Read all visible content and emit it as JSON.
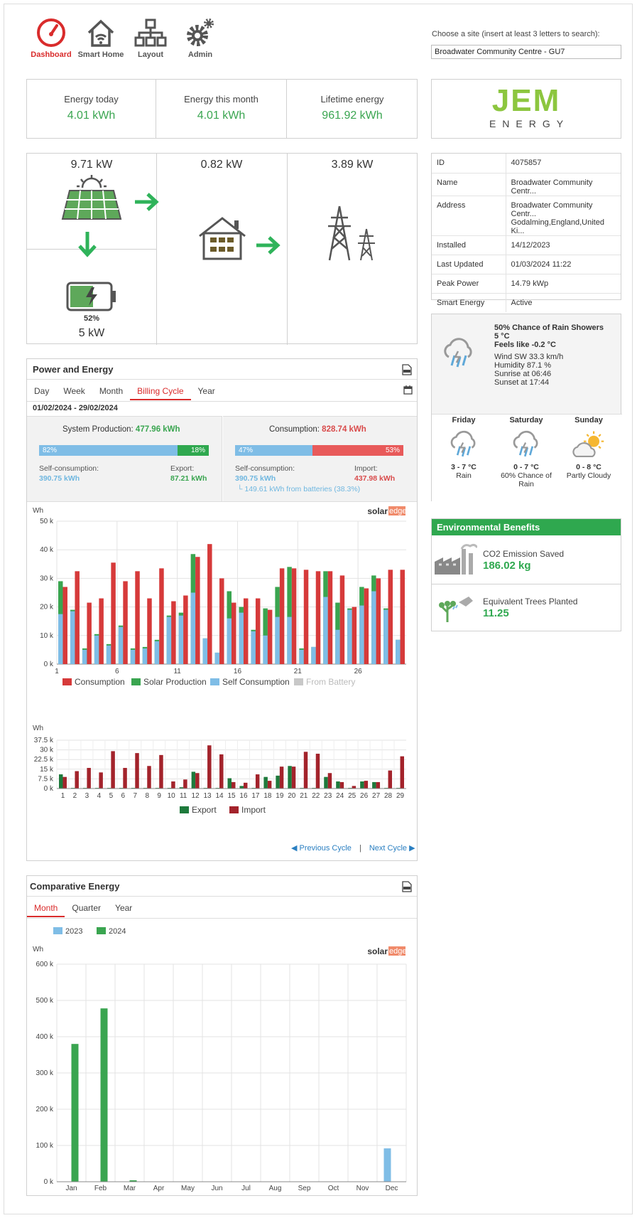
{
  "nav": [
    {
      "label": "Dashboard",
      "icon": "speedometer-icon",
      "active": true
    },
    {
      "label": "Smart Home",
      "icon": "smart-home-icon"
    },
    {
      "label": "Layout",
      "icon": "layout-tree-icon"
    },
    {
      "label": "Admin",
      "icon": "gears-icon"
    }
  ],
  "site_search": {
    "label": "Choose a site (insert at least 3 letters to search):",
    "value": "Broadwater Community Centre - GU7"
  },
  "stats": {
    "today_label": "Energy today",
    "today_value": "4.01 kWh",
    "month_label": "Energy this month",
    "month_value": "4.01 kWh",
    "lifetime_label": "Lifetime energy",
    "lifetime_value": "961.92 kWh"
  },
  "logo": {
    "top": "JEM",
    "bottom": "ENERGY"
  },
  "flow": {
    "solar_kw": "9.71 kW",
    "house_kw": "0.82 kW",
    "grid_kw": "3.89 kW",
    "battery_pct": "52%",
    "battery_kw": "5 kW"
  },
  "site_info": [
    {
      "k": "ID",
      "v": "4075857"
    },
    {
      "k": "Name",
      "v": "Broadwater Community Centr..."
    },
    {
      "k": "Address",
      "v": "Broadwater Community Centr...",
      "v2": "Godalming,England,United Ki..."
    },
    {
      "k": "Installed",
      "v": "14/12/2023"
    },
    {
      "k": "Last Updated",
      "v": "01/03/2024 11:22"
    },
    {
      "k": "Peak Power",
      "v": "14.79 kWp"
    },
    {
      "k": "Smart Energy",
      "v": "Active"
    }
  ],
  "weather": {
    "now": {
      "line1": "50% Chance of Rain Showers",
      "line2": "5 °C",
      "line3": "Feels like -0.2 °C",
      "wind": "Wind SW 33.3 km/h",
      "humidity": "Humidity 87.1 %",
      "sunrise": "Sunrise at 06:46",
      "sunset": "Sunset at 17:44"
    },
    "days": [
      {
        "day": "Friday",
        "temp": "3 - 7 °C",
        "desc": "Rain",
        "icon": "rain-cloud-icon"
      },
      {
        "day": "Saturday",
        "temp": "0 - 7 °C",
        "desc": "60% Chance of Rain",
        "icon": "rain-cloud-icon"
      },
      {
        "day": "Sunday",
        "temp": "0 - 8 °C",
        "desc": "Partly Cloudy",
        "icon": "partly-cloudy-icon"
      }
    ]
  },
  "env": {
    "title": "Environmental Benefits",
    "co2_label": "CO2 Emission Saved",
    "co2_value": "186.02 kg",
    "trees_label": "Equivalent Trees Planted",
    "trees_value": "11.25"
  },
  "power": {
    "title": "Power and Energy",
    "tabs": [
      "Day",
      "Week",
      "Month",
      "Billing Cycle",
      "Year"
    ],
    "active_tab": "Billing Cycle",
    "range": "01/02/2024 - 29/02/2024",
    "prod_label": "System Production:",
    "prod_value": "477.96 kWh",
    "prod_self_pct": "82%",
    "prod_export_pct": "18%",
    "self_cons_label": "Self-consumption:",
    "self_cons_value": "390.75 kWh",
    "export_label": "Export:",
    "export_value": "87.21 kWh",
    "cons_label": "Consumption:",
    "cons_value": "828.74 kWh",
    "cons_self_pct": "47%",
    "cons_import_pct": "53%",
    "cons_self_label": "Self-consumption:",
    "cons_self_value": "390.75 kWh",
    "import_label": "Import:",
    "import_value": "437.98 kWh",
    "batteries_note": "└ 149.61 kWh from batteries (38.3%)",
    "prev": "Previous Cycle",
    "sep": "|",
    "next": "Next Cycle"
  },
  "colors": {
    "red": "#d63a3a",
    "green": "#3aa550",
    "blue": "#7fbde6",
    "grey": "#c8c8c8",
    "dark_green": "#1e7a3c",
    "dark_red": "#a3232b"
  },
  "chart_data": [
    {
      "type": "bar",
      "ylabel": "Wh",
      "ylim": [
        0,
        50000
      ],
      "yticks": [
        "0 k",
        "10 k",
        "20 k",
        "30 k",
        "40 k",
        "50 k"
      ],
      "xticks": [
        "1",
        "6",
        "11",
        "16",
        "21",
        "26"
      ],
      "x": [
        1,
        2,
        3,
        4,
        5,
        6,
        7,
        8,
        9,
        10,
        11,
        12,
        13,
        14,
        15,
        16,
        17,
        18,
        19,
        20,
        21,
        22,
        23,
        24,
        25,
        26,
        27,
        28,
        29
      ],
      "series": [
        {
          "name": "Consumption",
          "values": [
            27000,
            32500,
            21500,
            23000,
            35500,
            29000,
            32500,
            23000,
            33500,
            22000,
            24000,
            37500,
            42000,
            30000,
            21500,
            23000,
            23000,
            19000,
            33500,
            33500,
            33000,
            32500,
            32500,
            31000,
            20000,
            26500,
            30000,
            33000,
            33000
          ]
        },
        {
          "name": "Solar Production",
          "values": [
            29000,
            19000,
            5500,
            10500,
            7000,
            13500,
            5500,
            6000,
            8500,
            17000,
            18000,
            38500,
            9000,
            4000,
            25500,
            20000,
            12000,
            19500,
            27000,
            34000,
            5500,
            6000,
            32500,
            21500,
            19500,
            27000,
            31000,
            19500,
            8500
          ]
        },
        {
          "name": "Self Consumption",
          "values": [
            17500,
            18500,
            5000,
            10000,
            6500,
            13000,
            5000,
            5500,
            8000,
            16500,
            17000,
            25000,
            9000,
            4000,
            16000,
            18000,
            11500,
            10000,
            16500,
            16500,
            5000,
            6000,
            23500,
            12000,
            19000,
            20500,
            25500,
            19000,
            8500
          ]
        },
        {
          "name": "From Battery",
          "values": []
        }
      ]
    },
    {
      "type": "bar",
      "ylabel": "Wh",
      "ylim": [
        0,
        37500
      ],
      "yticks": [
        "0 k",
        "7.5 k",
        "15 k",
        "22.5 k",
        "30 k",
        "37.5 k"
      ],
      "categories": [
        "1",
        "2",
        "3",
        "4",
        "5",
        "6",
        "7",
        "8",
        "9",
        "10",
        "11",
        "12",
        "13",
        "14",
        "15",
        "16",
        "17",
        "18",
        "19",
        "20",
        "21",
        "22",
        "23",
        "24",
        "25",
        "26",
        "27",
        "28",
        "29"
      ],
      "series": [
        {
          "name": "Export",
          "values": [
            11000,
            500,
            500,
            500,
            500,
            500,
            500,
            500,
            500,
            500,
            1000,
            13000,
            500,
            500,
            8000,
            2000,
            500,
            9000,
            10000,
            17500,
            500,
            500,
            9000,
            5500,
            500,
            5500,
            5000,
            500,
            500
          ]
        },
        {
          "name": "Import",
          "values": [
            9000,
            13500,
            16000,
            12500,
            29000,
            16000,
            27500,
            17500,
            26000,
            5500,
            7000,
            12000,
            33500,
            26500,
            5000,
            4500,
            11000,
            6000,
            17000,
            17000,
            28500,
            27000,
            12000,
            5000,
            2000,
            6000,
            5000,
            14000,
            25000
          ]
        }
      ]
    },
    {
      "type": "bar",
      "title": "Comparative Energy",
      "ylabel": "Wh",
      "ylim": [
        0,
        600000
      ],
      "yticks": [
        "0 k",
        "100 k",
        "200 k",
        "300 k",
        "400 k",
        "500 k",
        "600 k"
      ],
      "categories": [
        "Jan",
        "Feb",
        "Mar",
        "Apr",
        "May",
        "Jun",
        "Jul",
        "Aug",
        "Sep",
        "Oct",
        "Nov",
        "Dec"
      ],
      "series": [
        {
          "name": "2023",
          "values": [
            0,
            0,
            0,
            0,
            0,
            0,
            0,
            0,
            0,
            0,
            0,
            92000
          ]
        },
        {
          "name": "2024",
          "values": [
            380000,
            478000,
            4000,
            0,
            0,
            0,
            0,
            0,
            0,
            0,
            0,
            0
          ]
        }
      ]
    }
  ],
  "compare": {
    "title": "Comparative Energy",
    "tabs": [
      "Month",
      "Quarter",
      "Year"
    ],
    "active_tab": "Month"
  },
  "solaredge": {
    "a": "solar",
    "b": "edge"
  }
}
